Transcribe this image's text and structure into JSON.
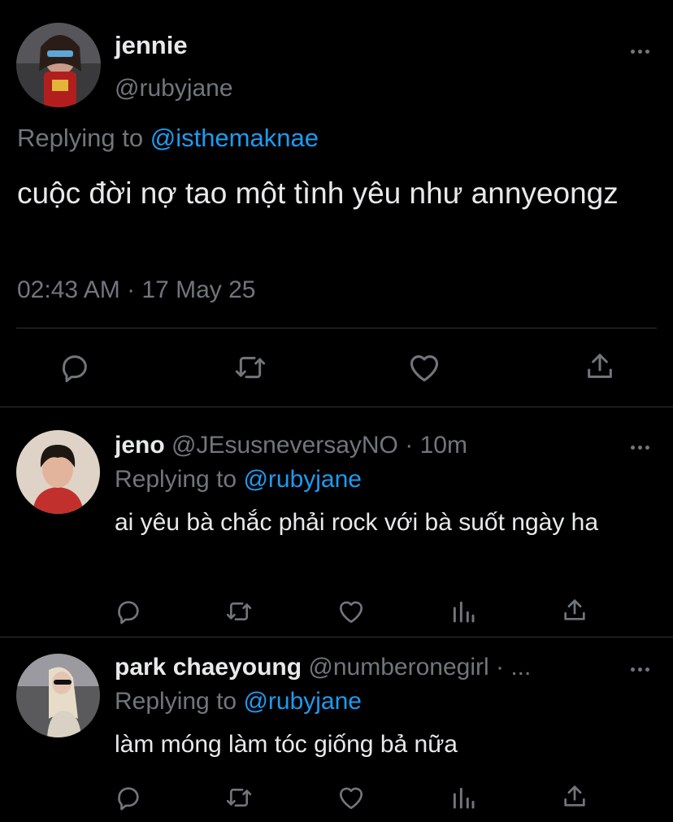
{
  "main_tweet": {
    "name": "jennie",
    "handle": "@rubyjane",
    "replying_prefix": "Replying to",
    "replying_to": "@isthemaknae",
    "text": "cuộc đời nợ tao một tình yêu như annyeongz",
    "timestamp": "02:43 AM · 17 May 25",
    "actions": [
      "reply-icon",
      "retweet-icon",
      "like-icon",
      "share-icon"
    ]
  },
  "replies": [
    {
      "name": "jeno",
      "handle": "@JEsusneversayNO",
      "time": "· 10m",
      "replying_prefix": "Replying to",
      "replying_to": "@rubyjane",
      "text": "ai yêu bà chắc phải rock với bà suốt ngày ha",
      "actions": [
        "reply-icon",
        "retweet-icon",
        "like-icon",
        "analytics-icon",
        "share-icon"
      ]
    },
    {
      "name": "park chaeyoung",
      "handle": "@numberonegirl",
      "time": "· ...",
      "replying_prefix": "Replying to",
      "replying_to": "@rubyjane",
      "text": "làm móng làm tóc giống bả nữa",
      "actions": [
        "reply-icon",
        "retweet-icon",
        "like-icon",
        "analytics-icon",
        "share-icon"
      ]
    }
  ],
  "colors": {
    "background": "#000000",
    "primary_text": "#e7e9ea",
    "secondary_text": "#71767b",
    "link": "#1d9bf0",
    "divider": "#2f3336"
  }
}
